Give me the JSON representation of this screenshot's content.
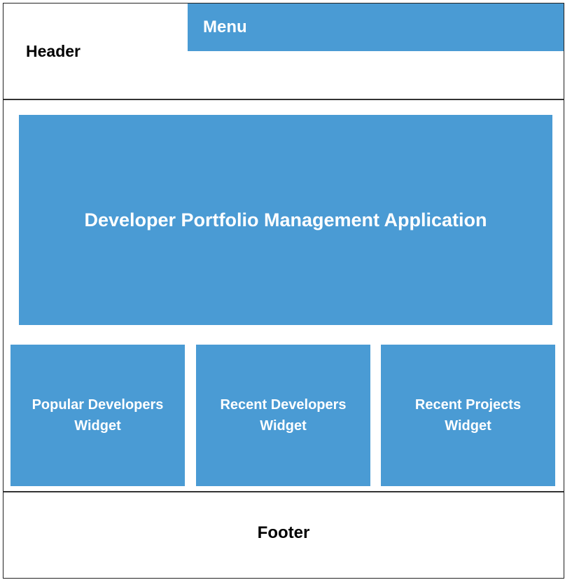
{
  "header": {
    "label": "Header"
  },
  "menu": {
    "label": "Menu"
  },
  "hero": {
    "title": "Developer Portfolio Management Application"
  },
  "widgets": [
    {
      "label": "Popular Developers\nWidget"
    },
    {
      "label": "Recent Developers\nWidget"
    },
    {
      "label": "Recent Projects\nWidget"
    }
  ],
  "footer": {
    "label": "Footer"
  },
  "colors": {
    "block_fill": "#4a9bd4",
    "block_text": "#ffffff",
    "border": "#333333",
    "label_text": "#000000"
  }
}
